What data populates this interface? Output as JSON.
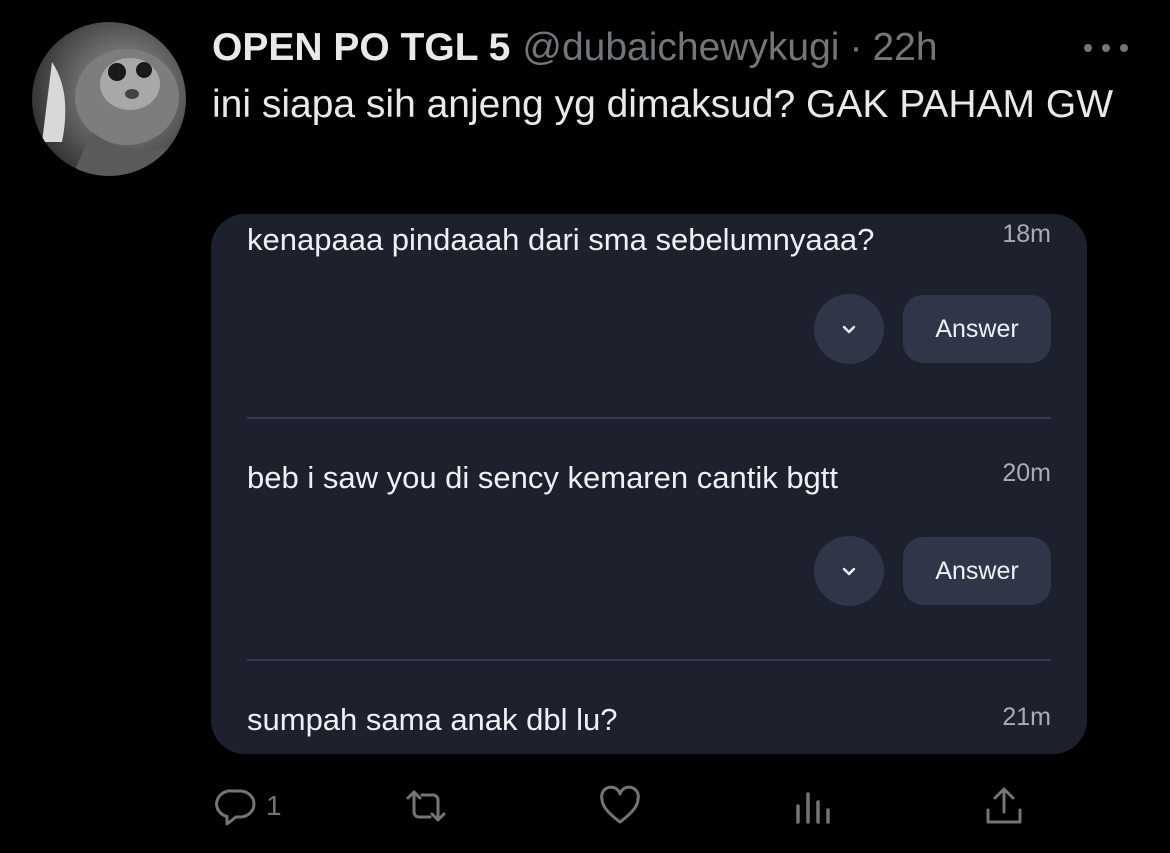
{
  "tweet": {
    "display_name": "OPEN PO TGL 5",
    "handle": "@dubaichewykugi",
    "separator": "·",
    "time": "22h",
    "text": "ini siapa sih anjeng yg dimaksud? GAK PAHAM GW",
    "avatar_icon": "cat-photo-avatar",
    "more_icon": "more-horizontal-icon"
  },
  "card": {
    "questions": [
      {
        "text": "kenapaaa pindaaah dari sma sebelumnyaaa?",
        "time": "18m",
        "answer_label": "Answer"
      },
      {
        "text": "beb i saw you di sency kemaren cantik bgtt",
        "time": "20m",
        "answer_label": "Answer"
      },
      {
        "text": "sumpah sama anak dbl lu?",
        "time": "21m"
      }
    ],
    "colors": {
      "card_bg": "#1c212d",
      "button_bg": "#2e3647",
      "divider": "#323a4b"
    }
  },
  "actions": {
    "reply_count": "1",
    "icons": [
      "reply-icon",
      "retweet-icon",
      "like-icon",
      "analytics-icon",
      "share-icon"
    ]
  },
  "colors": {
    "background": "#000000",
    "primary_text": "#e7e9ea",
    "secondary_text": "#71767b"
  }
}
